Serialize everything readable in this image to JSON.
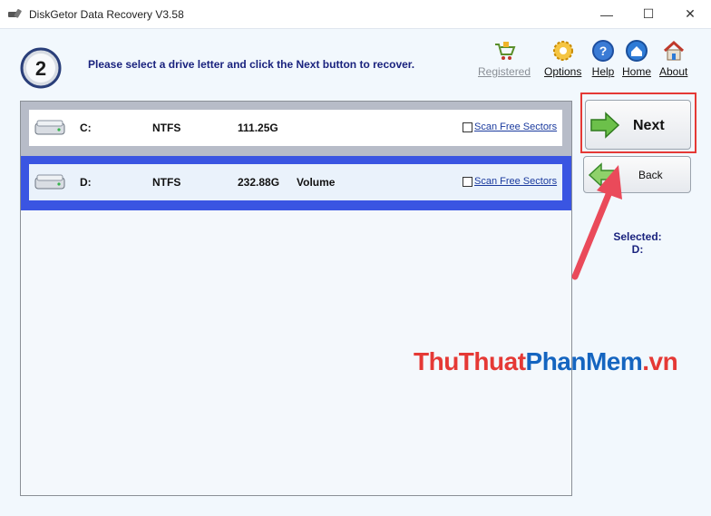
{
  "window": {
    "title": "DiskGetor Data Recovery V3.58",
    "minimize": "—",
    "maximize": "☐",
    "close": "✕"
  },
  "step": {
    "number": "2",
    "instruction": "Please select a drive letter and click the Next button to recover."
  },
  "toplinks": [
    {
      "label": "Registered",
      "icon": "cart-icon",
      "disabled": true
    },
    {
      "label": "Options",
      "icon": "gear-icon"
    },
    {
      "label": "Help",
      "icon": "help-icon"
    },
    {
      "label": "Home",
      "icon": "home-icon"
    },
    {
      "label": "About",
      "icon": "house-about-icon"
    }
  ],
  "drives": [
    {
      "letter": "C:",
      "fs": "NTFS",
      "size": "111.25G",
      "label": "",
      "scan_label": "Scan Free Sectors"
    },
    {
      "letter": "D:",
      "fs": "NTFS",
      "size": "232.88G",
      "label": "Volume",
      "scan_label": "Scan Free Sectors"
    }
  ],
  "buttons": {
    "next": "Next",
    "back": "Back"
  },
  "selected": {
    "label": "Selected:",
    "value": "D:"
  },
  "watermark": {
    "part1": "ThuThuat",
    "part2": "PhanMem",
    "part3": ".vn"
  },
  "colors": {
    "selection": "#3a55e2",
    "accent_text": "#1a237e",
    "highlight": "#e53935"
  }
}
